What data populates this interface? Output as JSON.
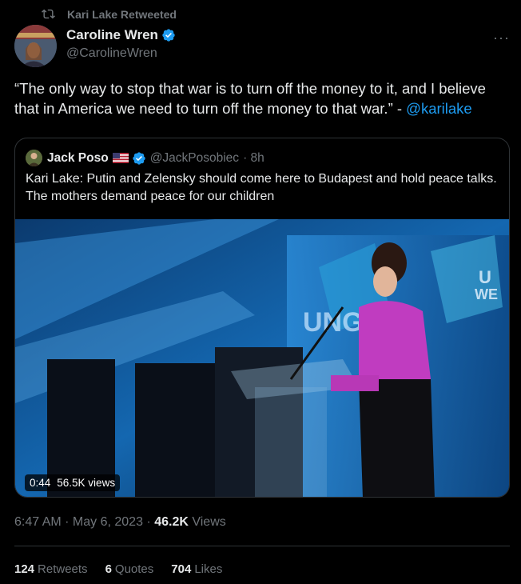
{
  "retweet": {
    "label": "Kari Lake Retweeted"
  },
  "author": {
    "name": "Caroline Wren",
    "handle": "@CarolineWren"
  },
  "tweet": {
    "text": "“The only way to stop that war is to turn off the money to it, and I believe that in America we need to turn off the money to that war.” - ",
    "mention": "@karilake"
  },
  "quote": {
    "name": "Jack Poso",
    "handle": "@JackPosobiec",
    "time": "· 8h",
    "text": "Kari Lake: Putin and Zelensky should come here to Budapest and hold peace talks. The mothers demand peace for our children",
    "video": {
      "duration": "0:44",
      "views": "56.5K views"
    }
  },
  "meta": {
    "timestamp": "6:47 AM · May 6, 2023 · ",
    "views_count": "46.2K",
    "views_label": " Views"
  },
  "stats": {
    "retweets_count": "124",
    "retweets_label": "Retweets",
    "quotes_count": "6",
    "quotes_label": "Quotes",
    "likes_count": "704",
    "likes_label": "Likes"
  },
  "colors": {
    "accent": "#1d9bf0",
    "muted": "#71767b",
    "background": "#000000"
  },
  "icons": {
    "retweet": "retweet-icon",
    "verified": "verified-icon",
    "more": "more-icon",
    "flag": "us-flag-icon"
  }
}
